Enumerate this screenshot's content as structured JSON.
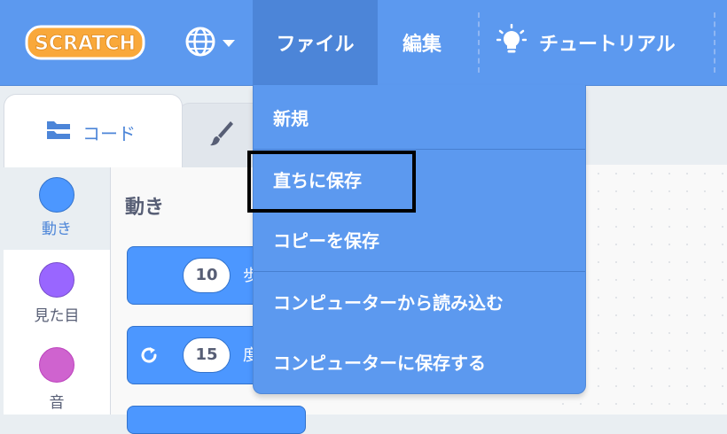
{
  "menubar": {
    "logo_text": "SCRATCH",
    "language_icon": "globe-icon",
    "file_label": "ファイル",
    "edit_label": "編集",
    "tutorial_label": "チュートリアル",
    "tutorial_icon": "lightbulb-icon"
  },
  "tabs": {
    "code_label": "コード",
    "costume_icon": "brush-icon"
  },
  "categories": [
    {
      "label": "動き",
      "color": "#4c97ff"
    },
    {
      "label": "見た目",
      "color": "#9966ff"
    },
    {
      "label": "音",
      "color": "#cf63cf"
    }
  ],
  "blocks": {
    "heading": "動き",
    "move_value": "10",
    "move_text": "歩",
    "turn_value": "15",
    "turn_text": "度"
  },
  "file_menu": {
    "items": [
      "新規",
      "直ちに保存",
      "コピーを保存",
      "コンピューターから読み込む",
      "コンピューターに保存する"
    ]
  },
  "colors": {
    "menubar": "#5c99ef",
    "menubar_active": "#4c85d8",
    "motion": "#4c97ff"
  }
}
